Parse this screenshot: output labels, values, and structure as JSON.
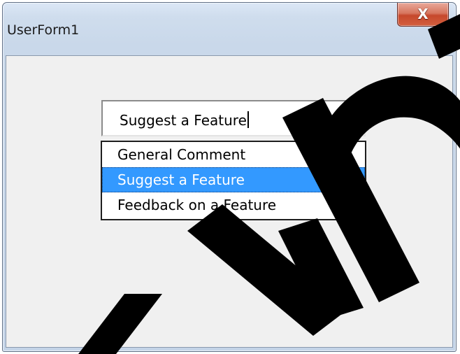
{
  "window": {
    "title": "UserForm1",
    "close_glyph": "X"
  },
  "combobox": {
    "value": "Suggest a Feature",
    "options": [
      "General Comment",
      "Suggest a Feature",
      "Feedback on a Feature"
    ],
    "selected_index": 1
  },
  "colors": {
    "selection": "#3399ff",
    "close_button": "#c6482c",
    "form_background": "#f0f0f0",
    "watermark": "#000000"
  }
}
